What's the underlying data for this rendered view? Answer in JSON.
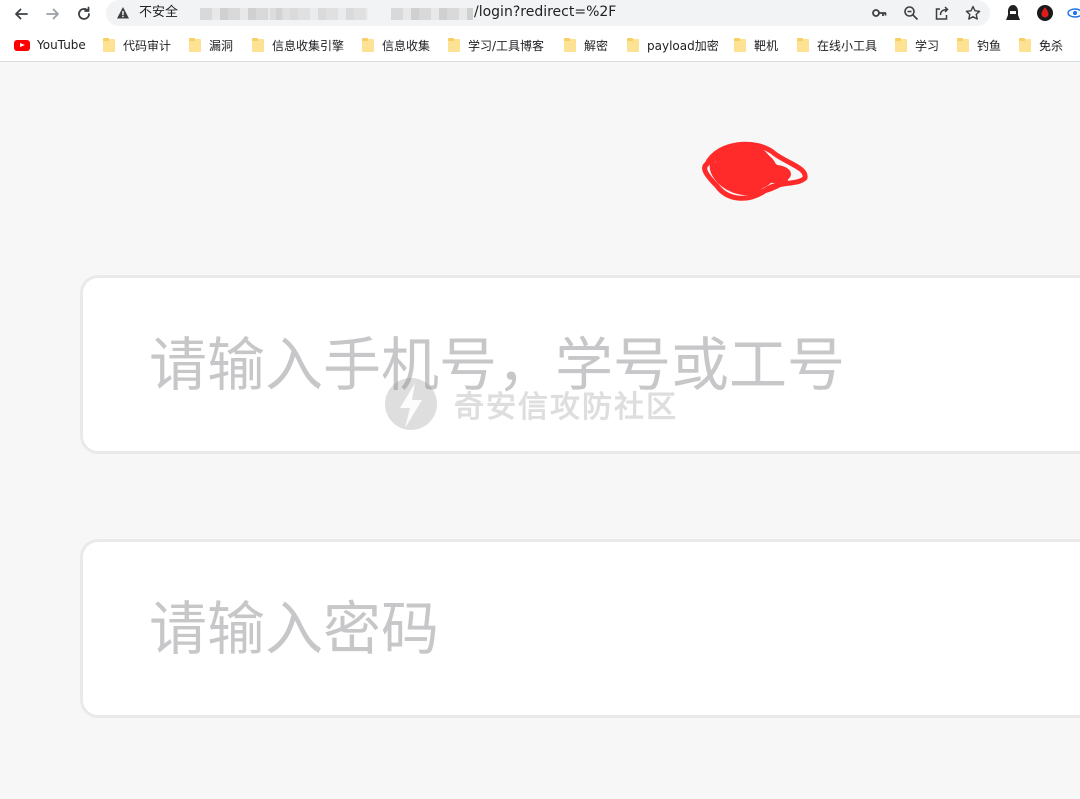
{
  "address_bar": {
    "security_label": "不安全",
    "url_path": "/login?redirect=%2F"
  },
  "bookmarks": [
    {
      "label": "YouTube",
      "icon": "youtube-icon"
    },
    {
      "label": "代码审计",
      "icon": "folder-icon"
    },
    {
      "label": "漏洞",
      "icon": "folder-icon"
    },
    {
      "label": "信息收集引擎",
      "icon": "folder-icon"
    },
    {
      "label": "信息收集",
      "icon": "folder-icon"
    },
    {
      "label": "学习/工具博客",
      "icon": "folder-icon"
    },
    {
      "label": "解密",
      "icon": "folder-icon"
    },
    {
      "label": "payload加密",
      "icon": "folder-icon"
    },
    {
      "label": "靶机",
      "icon": "folder-icon"
    },
    {
      "label": "在线小工具",
      "icon": "folder-icon"
    },
    {
      "label": "学习",
      "icon": "folder-icon"
    },
    {
      "label": "钓鱼",
      "icon": "folder-icon"
    },
    {
      "label": "免杀",
      "icon": "folder-icon"
    }
  ],
  "login": {
    "username_placeholder": "请输入手机号，学号或工号",
    "password_placeholder": "请输入密码"
  },
  "watermark": {
    "text": "奇安信攻防社区"
  },
  "colors": {
    "page_background": "#f7f7f7",
    "input_border": "#e9e9ea",
    "placeholder": "#c7c7c9",
    "logo_red": "#ff2a2a"
  }
}
